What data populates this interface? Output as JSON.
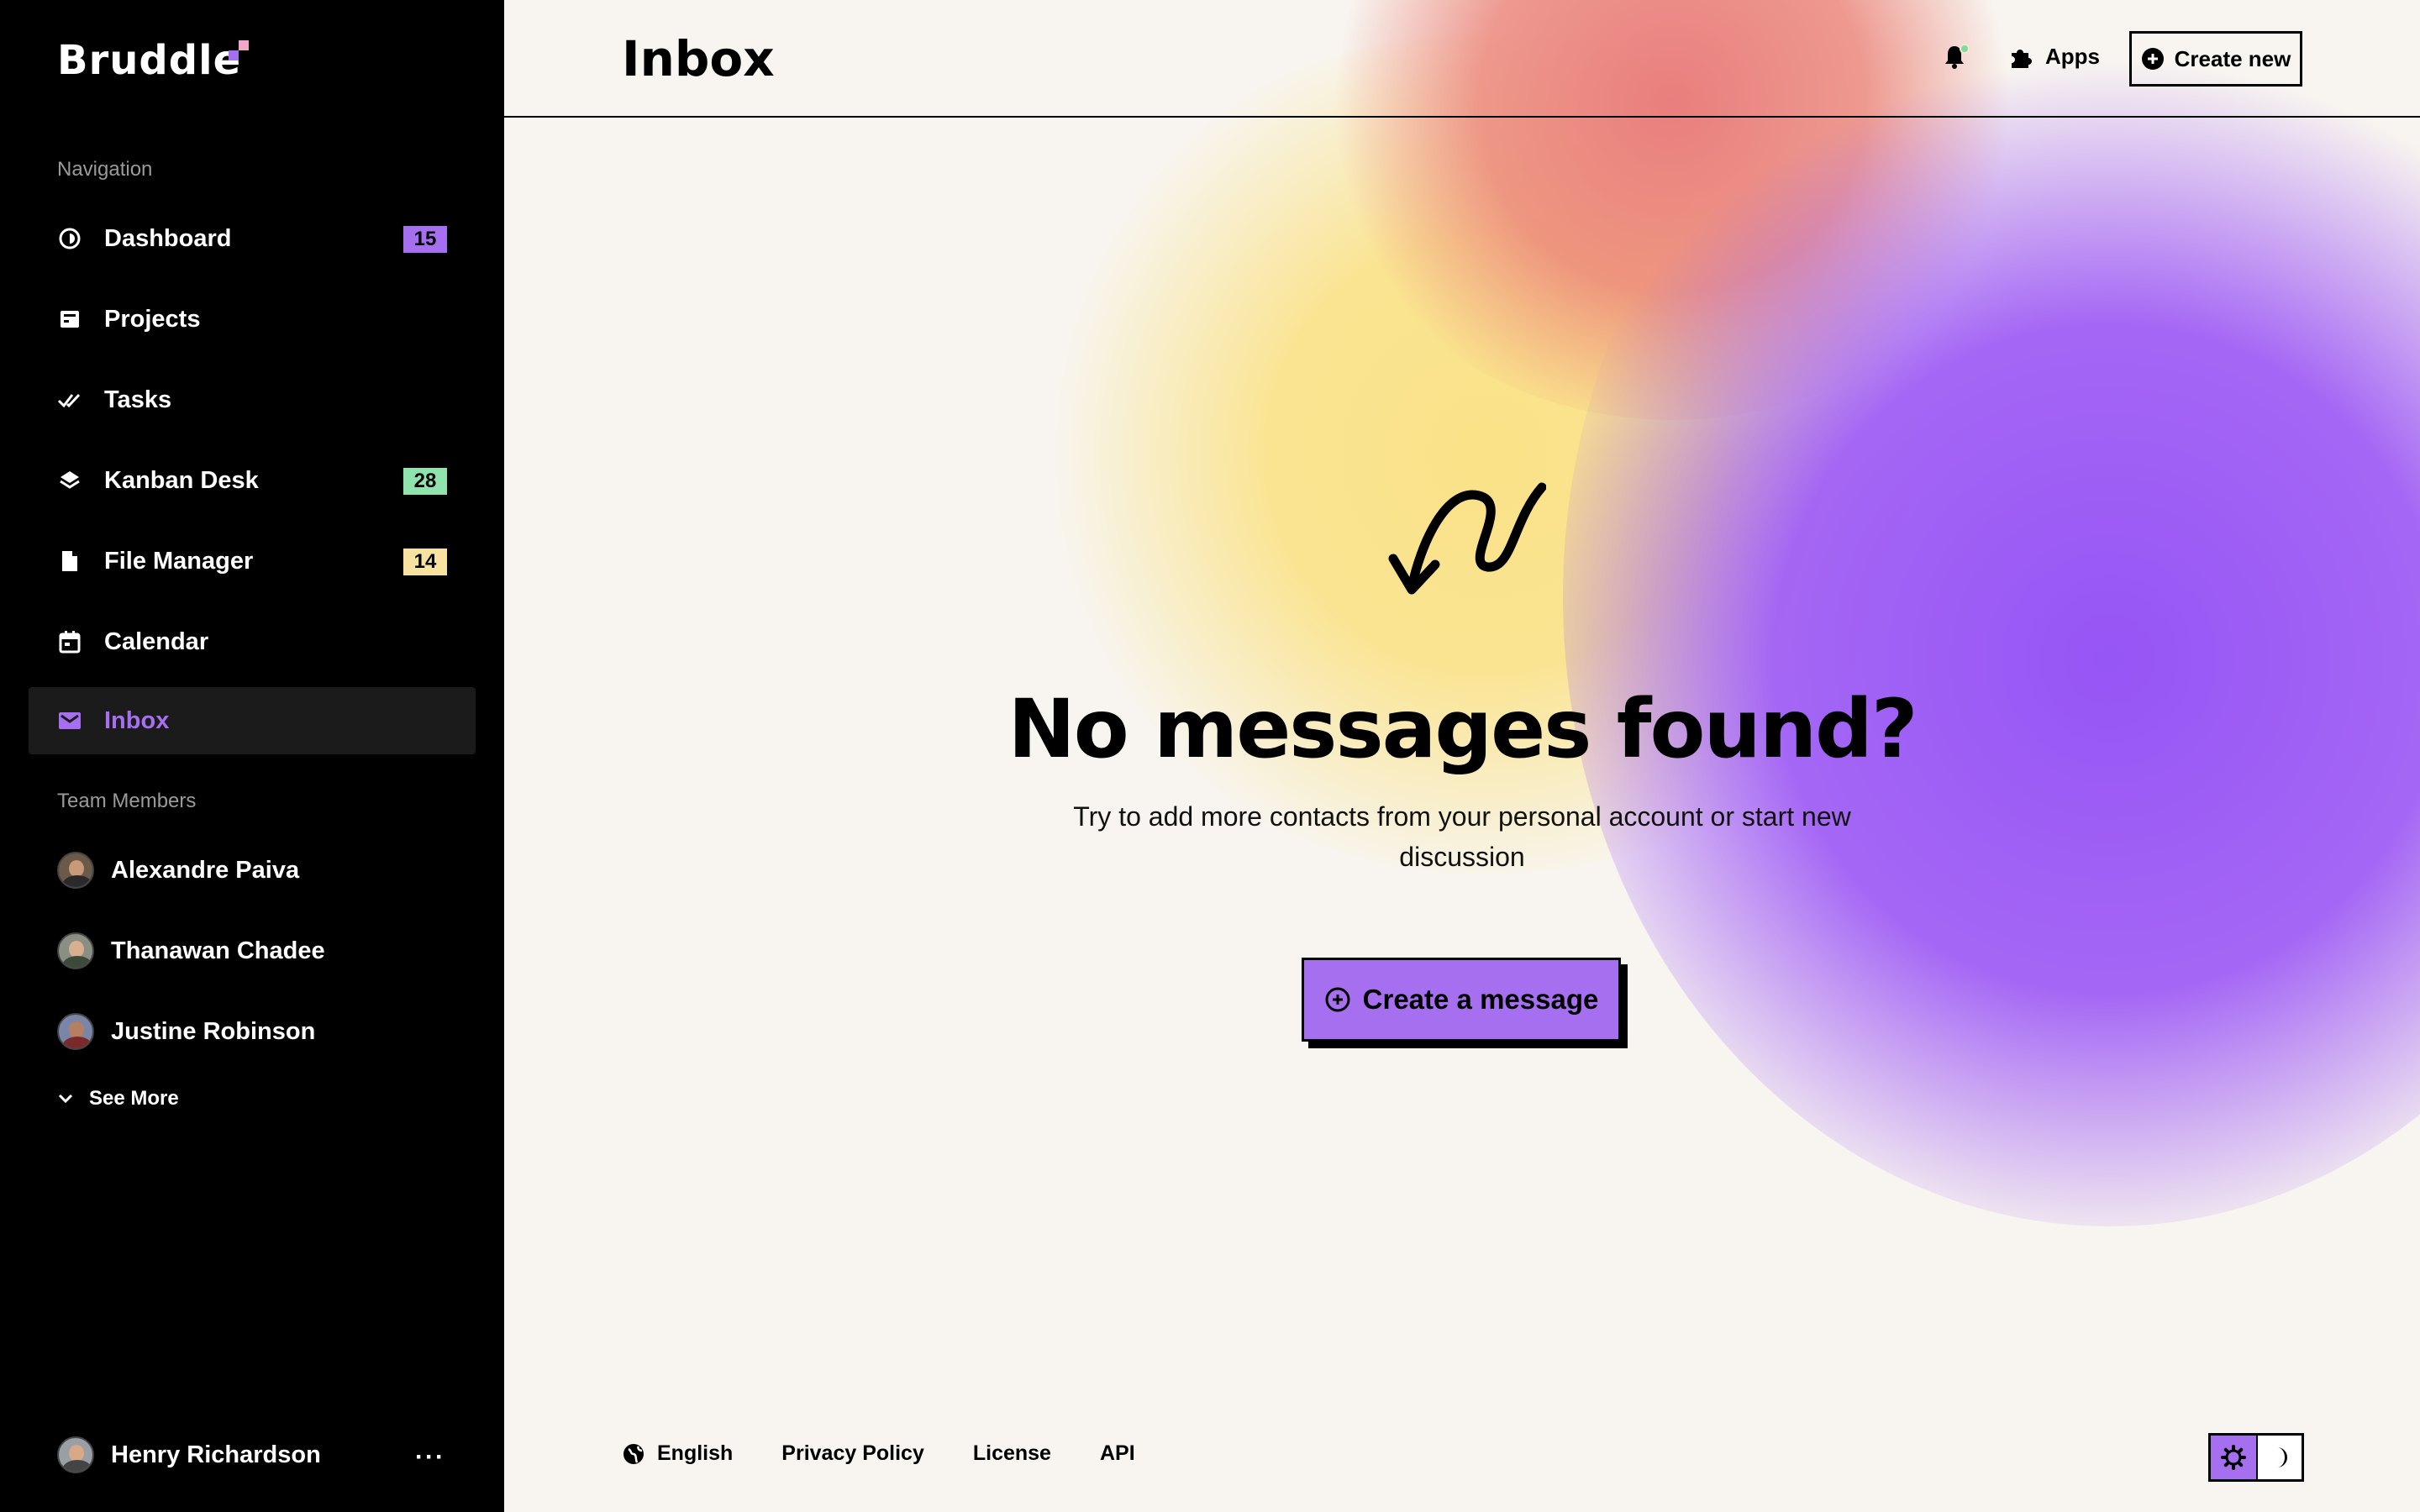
{
  "app": {
    "name": "Bruddle"
  },
  "sidebar": {
    "nav_label": "Navigation",
    "items": [
      {
        "label": "Dashboard",
        "icon": "dashboard-icon",
        "badge": "15",
        "badge_color": "#a66ff0"
      },
      {
        "label": "Projects",
        "icon": "projects-icon",
        "badge": null
      },
      {
        "label": "Tasks",
        "icon": "check-double-icon",
        "badge": null
      },
      {
        "label": "Kanban Desk",
        "icon": "layers-icon",
        "badge": "28",
        "badge_color": "#8fe3ad"
      },
      {
        "label": "File Manager",
        "icon": "file-icon",
        "badge": "14",
        "badge_color": "#f8e2a0"
      },
      {
        "label": "Calendar",
        "icon": "calendar-icon",
        "badge": null
      },
      {
        "label": "Inbox",
        "icon": "mail-icon",
        "badge": null,
        "active": true
      }
    ],
    "team_label": "Team Members",
    "members": [
      "Alexandre Paiva",
      "Thanawan Chadee",
      "Justine Robinson"
    ],
    "see_more": "See More",
    "current_user": "Henry Richardson",
    "more_label": "···"
  },
  "header": {
    "title": "Inbox",
    "apps_label": "Apps",
    "create_new_label": "Create new"
  },
  "empty_state": {
    "title": "No messages found?",
    "text": "Try to add more contacts from your personal account or start new discussion",
    "button_label": "Create a message"
  },
  "footer": {
    "language": "English",
    "links": [
      "Privacy Policy",
      "License",
      "API"
    ]
  },
  "colors": {
    "accent": "#a66ff0",
    "sidebar_bg": "#000000",
    "page_bg": "#f8f5f0"
  }
}
